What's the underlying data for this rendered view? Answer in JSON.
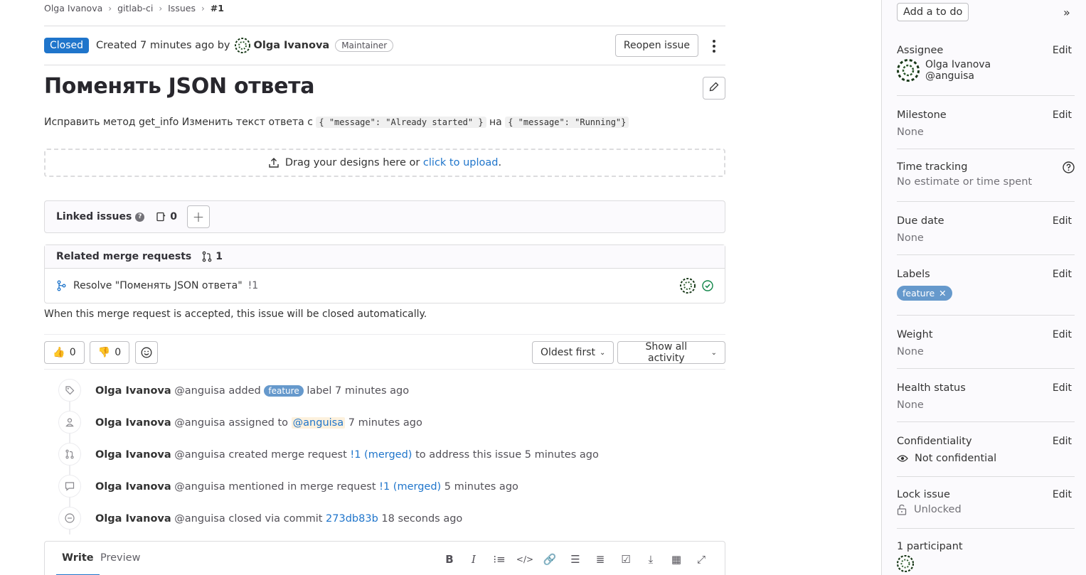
{
  "breadcrumb": [
    "Olga Ivanova",
    "gitlab-ci",
    "Issues",
    "#1"
  ],
  "header": {
    "status": "Closed",
    "created_text": "Created 7 minutes ago by",
    "author": "Olga Ivanova",
    "role": "Maintainer",
    "reopen_label": "Reopen issue"
  },
  "issue": {
    "title": "Поменять JSON ответа",
    "desc_prefix": "Исправить метод get_info Изменить текст ответа с",
    "code1": "{ \"message\": \"Already started\" }",
    "desc_mid": "на",
    "code2": "{ \"message\": \"Running\"}"
  },
  "dropzone": {
    "text": "Drag your designs here or",
    "link": "click to upload",
    "suffix": "."
  },
  "linked": {
    "title": "Linked issues",
    "count": "0"
  },
  "related_mr": {
    "title": "Related merge requests",
    "count": "1",
    "item_title": "Resolve \"Поменять JSON ответа\"",
    "item_ref": "!1",
    "note": "When this merge request is accepted, this issue will be closed automatically."
  },
  "reactions": {
    "thumbs_up": "0",
    "thumbs_down": "0",
    "sort": "Oldest first",
    "filter": "Show all activity"
  },
  "timeline": [
    {
      "icon": "tag-icon",
      "name": "Olga Ivanova",
      "handle": "@anguisa",
      "action": "added",
      "label": "feature",
      "tail": "label 7 minutes ago"
    },
    {
      "icon": "user-icon",
      "name": "Olga Ivanova",
      "handle": "@anguisa",
      "action": "assigned to",
      "mention": "@anguisa",
      "tail": "7 minutes ago"
    },
    {
      "icon": "merge-request-icon",
      "name": "Olga Ivanova",
      "handle": "@anguisa",
      "action": "created merge request",
      "link": "!1 (merged)",
      "tail": "to address this issue 5 minutes ago"
    },
    {
      "icon": "comment-icon",
      "name": "Olga Ivanova",
      "handle": "@anguisa",
      "action": "mentioned in merge request",
      "link": "!1 (merged)",
      "tail": "5 minutes ago"
    },
    {
      "icon": "closed-icon",
      "name": "Olga Ivanova",
      "handle": "@anguisa",
      "action": "closed via commit",
      "link": "273db83b",
      "tail": "18 seconds ago"
    }
  ],
  "editor": {
    "write": "Write",
    "preview": "Preview"
  },
  "sidebar": {
    "todo": "Add a to do",
    "edit": "Edit",
    "assignee": {
      "title": "Assignee",
      "name": "Olga Ivanova",
      "handle": "@anguisa"
    },
    "milestone": {
      "title": "Milestone",
      "value": "None"
    },
    "time_tracking": {
      "title": "Time tracking",
      "value": "No estimate or time spent"
    },
    "due_date": {
      "title": "Due date",
      "value": "None"
    },
    "labels": {
      "title": "Labels",
      "value": "feature"
    },
    "weight": {
      "title": "Weight",
      "value": "None"
    },
    "health": {
      "title": "Health status",
      "value": "None"
    },
    "confidentiality": {
      "title": "Confidentiality",
      "value": "Not confidential"
    },
    "lock": {
      "title": "Lock issue",
      "value": "Unlocked"
    },
    "participants": {
      "title": "1 participant"
    }
  },
  "colors": {
    "accent": "#1f75cb",
    "label": "#6699cc",
    "success": "#108548"
  }
}
